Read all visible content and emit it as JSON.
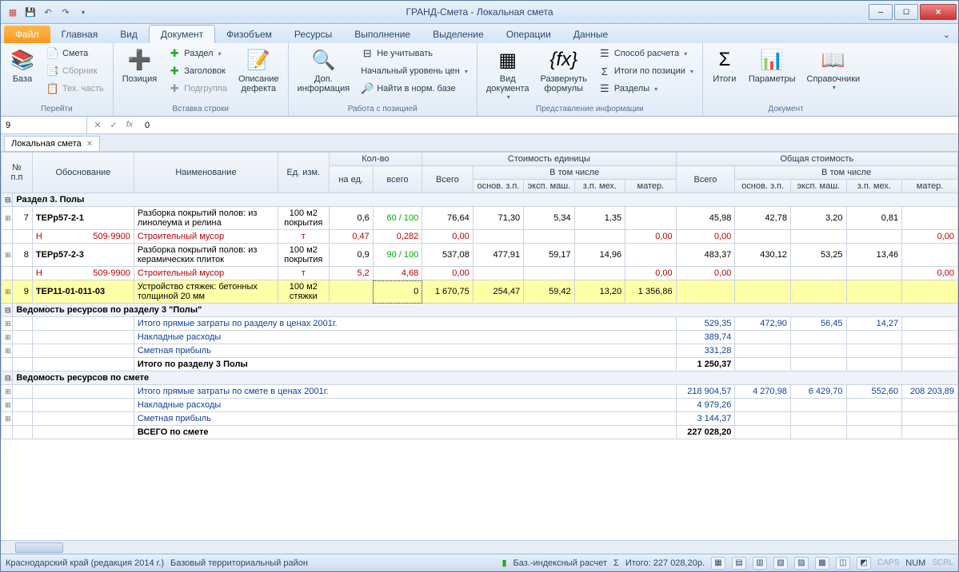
{
  "title": "ГРАНД-Смета - Локальная смета",
  "tabs": {
    "file": "Файл",
    "home": "Главная",
    "view": "Вид",
    "document": "Документ",
    "phys": "Физобъем",
    "resources": "Ресурсы",
    "exec": "Выполнение",
    "selection": "Выделение",
    "ops": "Операции",
    "data": "Данные"
  },
  "ribbon": {
    "g1": {
      "label": "Перейти",
      "base": "База",
      "smeta": "Смета",
      "sbornik": "Сборник",
      "tech": "Тех. часть"
    },
    "g2": {
      "label": "Вставка строки",
      "pos": "Позиция",
      "razdel": "Раздел",
      "zag": "Заголовок",
      "sub": "Подгруппа",
      "defect": "Описание\nдефекта"
    },
    "g3": {
      "label": "Работа с позицией",
      "dop": "Доп.\nинформация",
      "skip": "Не учитывать",
      "level": "Начальный уровень цен",
      "norm": "Найти в норм. базе"
    },
    "g4": {
      "label": "Представление информации",
      "viddoc": "Вид\nдокумента",
      "expand": "Развернуть\nформулы",
      "calc": "Способ расчета",
      "itogi": "Итоги по позиции",
      "razdely": "Разделы"
    },
    "g5": {
      "label": "Документ",
      "itogi": "Итоги",
      "params": "Параметры",
      "sprav": "Справочники"
    }
  },
  "fbar": {
    "name": "9",
    "formula": "0"
  },
  "doctab": "Локальная смета",
  "headers": {
    "npp": "№\nп.п",
    "osn": "Обоснование",
    "naim": "Наименование",
    "ed": "Ед. изм.",
    "kolvo": "Кол-во",
    "naed": "на ед.",
    "vsego": "всего",
    "stued": "Стоимость единицы",
    "vsego2": "Всего",
    "vtom": "В том числе",
    "oszp": "основ. з.п.",
    "em": "эксп. маш.",
    "zpm": "з.п. мех.",
    "mat": "матер.",
    "obst": "Общая стоимость"
  },
  "rows": {
    "section3": "Раздел 3. Полы",
    "r7": {
      "n": "7",
      "code": "ТЕРр57-2-1",
      "name": "Разборка покрытий полов: из линолеума и релина",
      "ed": "100 м2 покрытия",
      "naed": "0,6",
      "vs": "60 / 100",
      "vsego": "76,64",
      "oszp": "71,30",
      "em": "5,34",
      "zpm": "1,35",
      "t_vsego": "45,98",
      "t_oszp": "42,78",
      "t_em": "3,20",
      "t_zpm": "0,81"
    },
    "w7": {
      "h": "Н",
      "code": "509-9900",
      "name": "Строительный мусор",
      "ed": "т",
      "naed": "0,47",
      "vs": "0,282",
      "vsego": "0,00",
      "t_vsego": "0,00",
      "t_mat": "0,00",
      "mat": "0,00"
    },
    "r8": {
      "n": "8",
      "code": "ТЕРр57-2-3",
      "name": "Разборка покрытий полов: из керамических плиток",
      "ed": "100 м2 покрытия",
      "naed": "0,9",
      "vs": "90 / 100",
      "vsego": "537,08",
      "oszp": "477,91",
      "em": "59,17",
      "zpm": "14,96",
      "t_vsego": "483,37",
      "t_oszp": "430,12",
      "t_em": "53,25",
      "t_zpm": "13,46"
    },
    "w8": {
      "h": "Н",
      "code": "509-9900",
      "name": "Строительный мусор",
      "ed": "т",
      "naed": "5,2",
      "vs": "4,68",
      "vsego": "0,00",
      "t_vsego": "0,00",
      "t_mat": "0,00",
      "mat": "0,00"
    },
    "r9": {
      "n": "9",
      "code": "ТЕР11-01-011-03",
      "name": "Устройство стяжек: бетонных толщиной 20 мм",
      "ed": "100 м2 стяжки",
      "naed": "",
      "vs": "0",
      "vsego": "1 670,75",
      "oszp": "254,47",
      "em": "59,42",
      "zpm": "13,20",
      "mat": "1 356,86"
    },
    "ved3": "Ведомость ресурсов по разделу 3 \"Полы\"",
    "ipz3": "Итого прямые затраты по разделу в ценах 2001г.",
    "nr3": "Накладные расходы",
    "sp3": "Сметная прибыль",
    "it3": "Итого по разделу 3 Полы",
    "ipz3v": {
      "vsego": "529,35",
      "oszp": "472,90",
      "em": "56,45",
      "zpm": "14,27"
    },
    "nr3v": "389,74",
    "sp3v": "331,28",
    "it3v": "1 250,37",
    "vedsm": "Ведомость ресурсов по смете",
    "ipzsm": "Итого прямые затраты по смете в ценах 2001г.",
    "ipzsmv": {
      "vsego": "218 904,57",
      "oszp": "4 270,98",
      "em": "6 429,70",
      "zpm": "552,60",
      "mat": "208 203,89"
    },
    "nrsm": "Накладные расходы",
    "nrsmv": "4 979,26",
    "spsm": "Сметная прибыль",
    "spsmv": "3 144,37",
    "vsegosm": "ВСЕГО по смете",
    "vsegosmv": "227 028,20"
  },
  "status": {
    "region": "Краснодарский край (редакция 2014 г.)",
    "base": "Базовый территориальный район",
    "calc": "Баз.-индексный расчет",
    "total": "Итого: 227 028,20р.",
    "num": "NUM",
    "caps": "CAPS",
    "scrl": "SCRL"
  }
}
